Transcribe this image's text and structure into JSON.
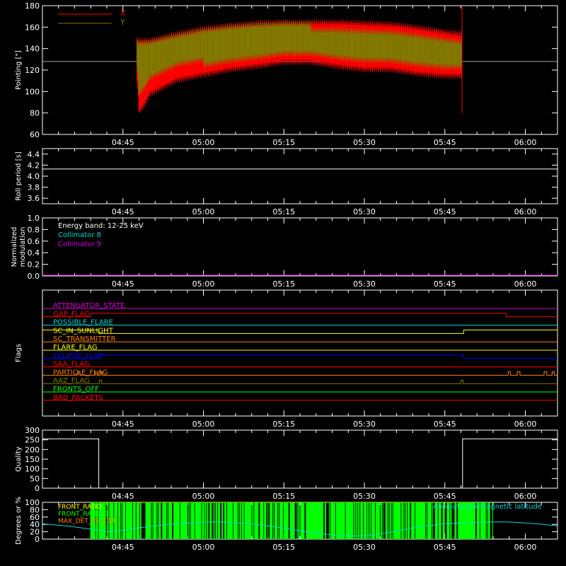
{
  "colors": {
    "bg": "#000000",
    "axis": "#ffffff",
    "red": "#ff0000",
    "olive": "#807800",
    "cyan": "#00d8d8",
    "magenta": "#d800d8",
    "yellow": "#ffff00",
    "orange": "#ff8000",
    "blue": "#0000ff",
    "green": "#00ff00",
    "white": "#ffffff",
    "gray": "#a0a0a0"
  },
  "x_ticks": [
    "04:45",
    "05:00",
    "05:15",
    "05:30",
    "05:45",
    "06:00"
  ],
  "chart_data": [
    {
      "id": "pointing",
      "type": "line",
      "ylabel": "Pointing [\"]",
      "ylim": [
        60,
        180
      ],
      "yticks": [
        "60",
        "80",
        "100",
        "120",
        "140",
        "160",
        "180"
      ],
      "x_unit": "minutes after 04:30",
      "xlim": [
        0,
        96
      ],
      "legend": [
        {
          "name": "X",
          "color": "#ff0000"
        },
        {
          "name": "Y",
          "color": "#807800"
        }
      ],
      "flat_line": 128,
      "data_start": 17.6,
      "data_end": 78.2,
      "upper_envelope": [
        [
          17.6,
          150
        ],
        [
          20,
          150
        ],
        [
          25,
          156
        ],
        [
          30,
          161
        ],
        [
          35,
          164
        ],
        [
          40,
          166
        ],
        [
          45,
          167
        ],
        [
          50,
          167
        ],
        [
          55,
          167
        ],
        [
          60,
          166
        ],
        [
          65,
          165
        ],
        [
          70,
          162
        ],
        [
          75,
          158
        ],
        [
          78,
          156
        ]
      ],
      "lower_envelope": [
        [
          17.6,
          110
        ],
        [
          18,
          78
        ],
        [
          19,
          85
        ],
        [
          20,
          95
        ],
        [
          25,
          108
        ],
        [
          30,
          113
        ],
        [
          35,
          118
        ],
        [
          40,
          121
        ],
        [
          45,
          125
        ],
        [
          50,
          125
        ],
        [
          55,
          121
        ],
        [
          60,
          118
        ],
        [
          65,
          118
        ],
        [
          70,
          114
        ],
        [
          75,
          112
        ],
        [
          78,
          112
        ]
      ]
    },
    {
      "id": "roll",
      "type": "line",
      "ylabel": "Roll period [s]",
      "ylim": [
        3.5,
        4.5
      ],
      "yticks": [
        "3.6",
        "3.8",
        "4.0",
        "4.2",
        "4.4"
      ],
      "constant": 4.13
    },
    {
      "id": "modulation",
      "type": "line",
      "ylabel": "Normalized modulation",
      "ylim": [
        0,
        1
      ],
      "yticks": [
        "0.0",
        "0.2",
        "0.4",
        "0.6",
        "0.8",
        "1.0"
      ],
      "annotations": [
        {
          "text": "Energy band: 12-25 keV",
          "color": "#ffffff"
        },
        {
          "text": "Collimator 8",
          "color": "#00d8d8"
        },
        {
          "text": "Collimator 9",
          "color": "#d800d8"
        }
      ]
    },
    {
      "id": "flags",
      "type": "line",
      "ylabel": "Flags",
      "series": [
        {
          "name": "ATTENUATOR_STATE",
          "color": "#d800d8",
          "steps": []
        },
        {
          "name": "GAP_FLAG",
          "color": "#ff0000",
          "steps": [
            [
              9,
              86.5
            ]
          ]
        },
        {
          "name": "POSSIBLE_FLARE",
          "color": "#00d8d8",
          "steps": []
        },
        {
          "name": "SC_IN_SUNLIGHT",
          "color": "#ffff00",
          "steps": [
            [
              0,
              10.5
            ],
            [
              78.5,
              96
            ]
          ],
          "invert": true
        },
        {
          "name": "SC_TRANSMITTER",
          "color": "#ff8000",
          "steps": []
        },
        {
          "name": "FLARE_FLAG",
          "color": "#ffff00",
          "steps": []
        },
        {
          "name": "ECLIPSE_FLAG",
          "color": "#0000ff",
          "steps": [
            [
              10.5,
              78.5
            ]
          ],
          "invert": true
        },
        {
          "name": "SAA_FLAG",
          "color": "#ff0000",
          "steps": []
        },
        {
          "name": "PARTICLE_FLAG",
          "color": "#ff8000",
          "steps": [
            [
              6.5,
              7.0
            ],
            [
              9.8,
              10.2
            ],
            [
              10.8,
              11.1
            ],
            [
              86.8,
              87.2
            ],
            [
              88.5,
              89.0
            ],
            [
              93.5,
              94.0
            ],
            [
              95.0,
              95.4
            ]
          ],
          "invert": true
        },
        {
          "name": "AAZ_FLAG",
          "color": "#807800",
          "steps": [
            [
              10.6,
              11.0
            ],
            [
              78.0,
              78.4
            ]
          ]
        },
        {
          "name": "FRONTS_OFF",
          "color": "#00ff00",
          "steps": []
        },
        {
          "name": "BAD_PACKETS",
          "color": "#ff0000",
          "steps": []
        }
      ]
    },
    {
      "id": "quality",
      "type": "line",
      "ylabel": "Quality",
      "ylim": [
        0,
        300
      ],
      "yticks": [
        "0",
        "50",
        "100",
        "150",
        "200",
        "250",
        "300"
      ],
      "segments": [
        [
          [
            0,
            255
          ],
          [
            10.5,
            255
          ],
          [
            10.5,
            0
          ],
          [
            78.3,
            0
          ],
          [
            78.3,
            255
          ],
          [
            96,
            255
          ]
        ]
      ]
    },
    {
      "id": "ratios",
      "type": "line",
      "ylabel": "Degrees or %",
      "ylim": [
        0,
        100
      ],
      "yticks": [
        "0",
        "20",
        "40",
        "60",
        "80",
        "100"
      ],
      "legend": [
        {
          "name": "FRONT_RATIO",
          "color": "#ffff00"
        },
        {
          "name": "FRONT_RATIO_1",
          "color": "#00ff00"
        },
        {
          "name": "MAX_DET_VS_TOT",
          "color": "#ff8000"
        }
      ],
      "annotation": {
        "text": "Absolute geomagnetic latitude",
        "color": "#00d8d8"
      },
      "green_range": [
        9,
        84
      ],
      "yellow_box": [
        9,
        80
      ],
      "latitude": [
        [
          0,
          42
        ],
        [
          5,
          35
        ],
        [
          10,
          25
        ],
        [
          12,
          20
        ],
        [
          15,
          24
        ],
        [
          20,
          35
        ],
        [
          25,
          42
        ],
        [
          30,
          46
        ],
        [
          32,
          47
        ],
        [
          35,
          46
        ],
        [
          40,
          40
        ],
        [
          45,
          30
        ],
        [
          50,
          18
        ],
        [
          55,
          10
        ],
        [
          58,
          8
        ],
        [
          62,
          12
        ],
        [
          66,
          22
        ],
        [
          70,
          33
        ],
        [
          75,
          42
        ],
        [
          80,
          45
        ],
        [
          85,
          47
        ],
        [
          88,
          46
        ],
        [
          92,
          42
        ],
        [
          96,
          36
        ]
      ]
    }
  ]
}
